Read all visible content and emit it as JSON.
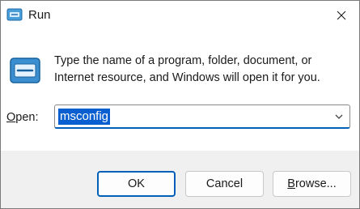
{
  "window": {
    "title": "Run",
    "app_icon": "run-icon",
    "close_icon": "close-icon"
  },
  "content": {
    "description_line1": "Type the name of a program, folder, document, or",
    "description_line2": "Internet resource, and Windows will open it for you.",
    "big_icon": "run-icon"
  },
  "open_field": {
    "label_first": "O",
    "label_rest": "pen:",
    "value": "msconfig",
    "dropdown_icon": "chevron-down-icon"
  },
  "buttons": {
    "ok": "OK",
    "cancel": "Cancel",
    "browse_first": "B",
    "browse_rest": "rowse..."
  },
  "colors": {
    "accent": "#005fb8",
    "selection": "#0a5fd0",
    "title_background": "#ffffff",
    "footer_background": "#f0f0f0"
  }
}
